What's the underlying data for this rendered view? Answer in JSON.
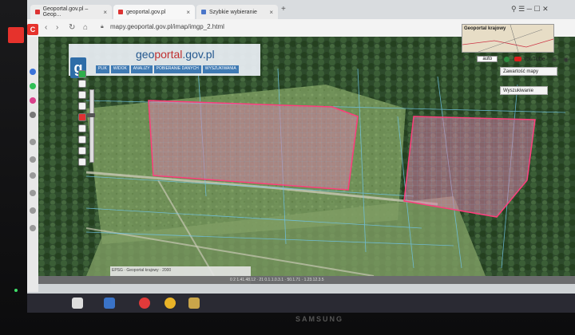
{
  "browser": {
    "tabs": [
      {
        "title": "Geoportal.gov.pl – Geop...",
        "active": false
      },
      {
        "title": "geoportal.gov.pl",
        "active": true
      },
      {
        "title": "Szybkie wybieranie",
        "active": false
      }
    ],
    "url": "mapy.geoportal.gov.pl/imap/imgp_2.html",
    "logo_letter": "C"
  },
  "geoportal": {
    "logo_letter": "g",
    "title_a": "geo",
    "title_b": "portal",
    "title_c": ".gov.pl",
    "menu": [
      "PLIK",
      "WIDOK",
      "ANALIZY",
      "POBIERANIE DANYCH",
      "WYSZUKIWANIA"
    ],
    "minimap_label": "Geoportal krajowy",
    "zoom_select": "auto",
    "youtube_label": "YouTube",
    "panel_map_contents": "Zawartość mapy",
    "panel_search": "Wyszukiwanie"
  },
  "status": {
    "coords": "0 2 1.41.48.12 · 21 0.1.1.0.3.1 · 50.1.71 · 1.23.12.3.5",
    "scale_box": "EPSG · Geoportal krajowy · 2000"
  },
  "device": {
    "brand": "SAMSUNG"
  },
  "colors": {
    "parcel_fill": "#d77fa6",
    "parcel_stroke": "#ff3c7a",
    "parcel_grid": "#6fc3e6"
  }
}
